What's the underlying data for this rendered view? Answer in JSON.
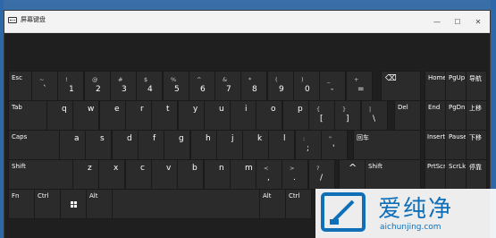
{
  "window": {
    "title": "屏幕键盘"
  },
  "titlebar_buttons": {
    "minimize": "—",
    "maximize": "☐",
    "close": "✕"
  },
  "colors": {
    "key_bg": "#2b2b2b",
    "window_bg": "#1f1f1f",
    "titlebar": "#f3f3f3"
  },
  "keys": {
    "esc": "Esc",
    "tab": "Tab",
    "caps": "Caps",
    "shift_l": "Shift",
    "shift_r": "Shift",
    "fn": "Fn",
    "ctrl_l": "Ctrl",
    "alt_l": "Alt",
    "alt_r": "Alt",
    "ctrl_r": "Ctrl",
    "del": "Del",
    "enter_cn": "回车",
    "backspace": "⌫",
    "up_arrow": "^",
    "home": "Home",
    "pgup": "PgUp",
    "nav_cn": "导航",
    "end": "End",
    "pgdn": "PgDn",
    "moveup_cn": "上移",
    "insert": "Insert",
    "pause": "Pause",
    "movedown_cn": "下移",
    "prtscn": "PrtScn",
    "scrlk": "ScrLk",
    "dock_cn": "停靠"
  },
  "num_row": [
    {
      "top": "~",
      "bot": "`"
    },
    {
      "top": "!",
      "bot": "1"
    },
    {
      "top": "@",
      "bot": "2"
    },
    {
      "top": "#",
      "bot": "3"
    },
    {
      "top": "$",
      "bot": "4"
    },
    {
      "top": "%",
      "bot": "5"
    },
    {
      "top": "^",
      "bot": "6"
    },
    {
      "top": "&",
      "bot": "7"
    },
    {
      "top": "*",
      "bot": "8"
    },
    {
      "top": "(",
      "bot": "9"
    },
    {
      "top": ")",
      "bot": "0"
    },
    {
      "top": "_",
      "bot": "-"
    },
    {
      "top": "+",
      "bot": "="
    }
  ],
  "row_q": [
    "q",
    "w",
    "e",
    "r",
    "t",
    "y",
    "u",
    "i",
    "o",
    "p"
  ],
  "row_q_sym": [
    {
      "top": "{",
      "bot": "["
    },
    {
      "top": "}",
      "bot": "]"
    },
    {
      "top": "|",
      "bot": "\\"
    }
  ],
  "row_a": [
    "a",
    "s",
    "d",
    "f",
    "g",
    "h",
    "j",
    "k",
    "l"
  ],
  "row_a_sym": [
    {
      "top": ":",
      "bot": ";"
    },
    {
      "top": "\"",
      "bot": "'"
    }
  ],
  "row_z": [
    "z",
    "x",
    "c",
    "v",
    "b",
    "n",
    "m"
  ],
  "row_z_sym": [
    {
      "top": "<",
      "bot": ","
    },
    {
      "top": ">",
      "bot": "."
    },
    {
      "top": "?",
      "bot": "/"
    }
  ],
  "watermark": {
    "text": "爱纯净",
    "url": "aichunjing.com"
  }
}
